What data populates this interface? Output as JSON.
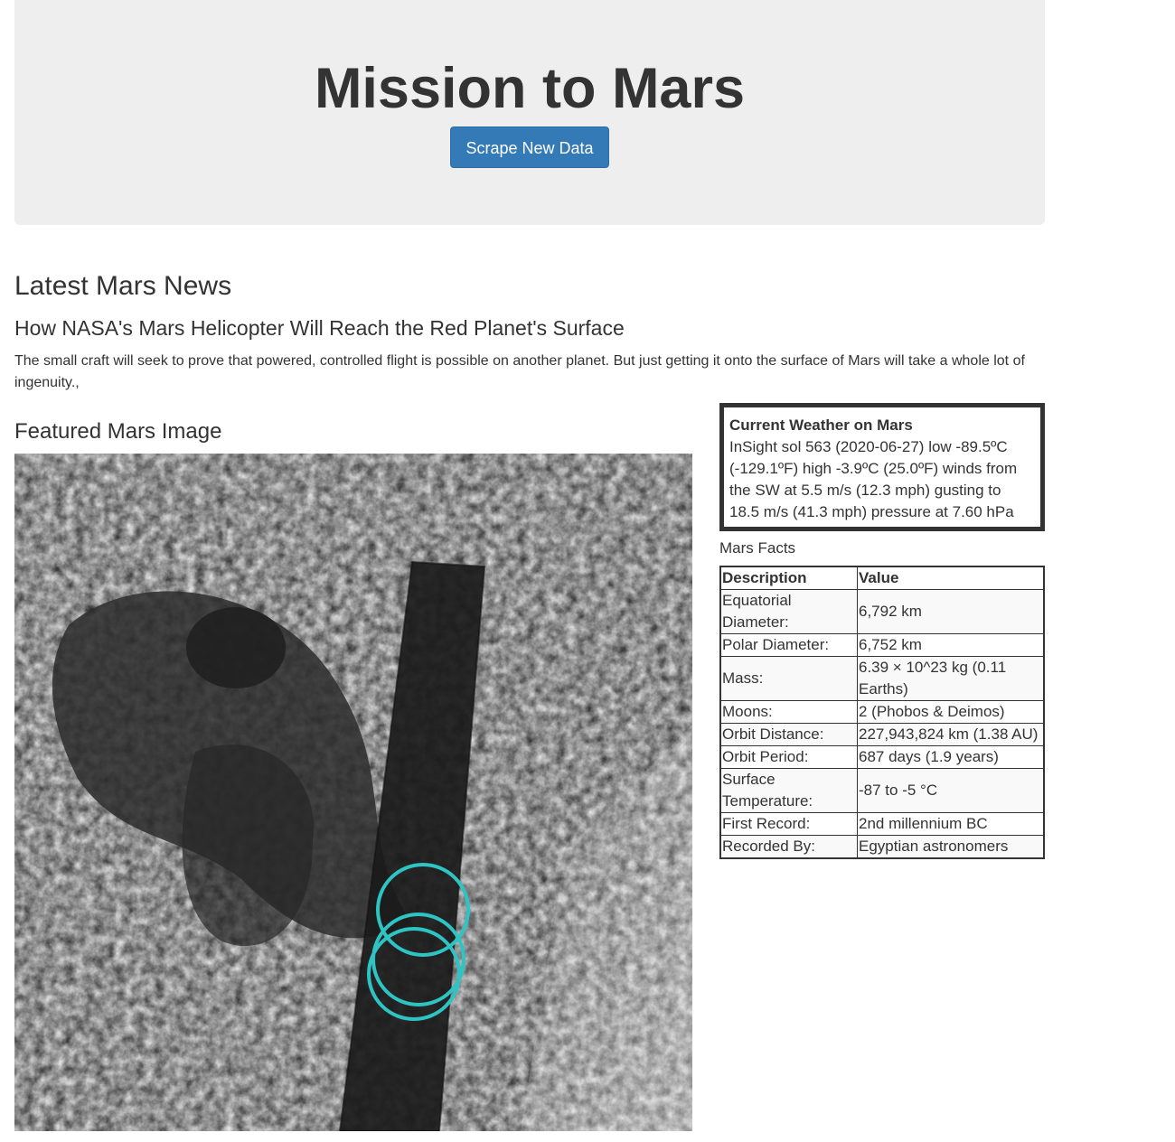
{
  "header": {
    "title": "Mission to Mars",
    "scrape_button": "Scrape New Data"
  },
  "news": {
    "section_heading": "Latest Mars News",
    "title": "How NASA's Mars Helicopter Will Reach the Red Planet's Surface",
    "paragraph": "The small craft will seek to prove that powered, controlled flight is possible on another planet. But just getting it onto the surface of Mars will take a whole lot of ingenuity.,"
  },
  "featured": {
    "heading": "Featured Mars Image"
  },
  "weather": {
    "title": "Current Weather on Mars",
    "text": "InSight sol 563 (2020-06-27) low -89.5ºC (-129.1ºF) high -3.9ºC (25.0ºF) winds from the SW at 5.5 m/s (12.3 mph) gusting to 18.5 m/s (41.3 mph) pressure at 7.60 hPa"
  },
  "facts": {
    "heading": "Mars Facts",
    "columns": [
      "Description",
      "Value"
    ],
    "rows": [
      [
        "Equatorial Diameter:",
        "6,792 km"
      ],
      [
        "Polar Diameter:",
        "6,752 km"
      ],
      [
        "Mass:",
        "6.39 × 10^23 kg (0.11 Earths)"
      ],
      [
        "Moons:",
        "2 (Phobos & Deimos)"
      ],
      [
        "Orbit Distance:",
        "227,943,824 km (1.38 AU)"
      ],
      [
        "Orbit Period:",
        "687 days (1.9 years)"
      ],
      [
        "Surface Temperature:",
        "-87 to -5 °C"
      ],
      [
        "First Record:",
        "2nd millennium BC"
      ],
      [
        "Recorded By:",
        "Egyptian astronomers"
      ]
    ]
  },
  "colors": {
    "accent": "#337ab7",
    "jumbotron_bg": "#eeeeee",
    "text": "#333333",
    "highlight_rings": "#2ec4c4"
  }
}
